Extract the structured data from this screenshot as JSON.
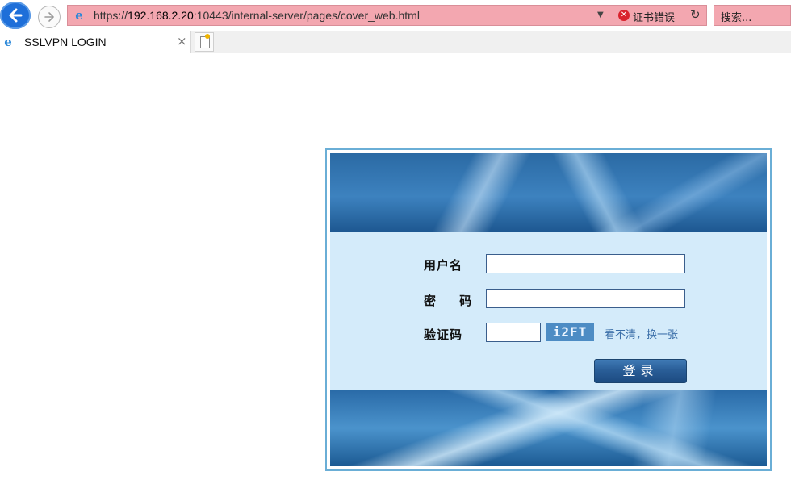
{
  "browser": {
    "url_scheme": "https://",
    "url_host": "192.168.2.20",
    "url_rest": ":10443/internal-server/pages/cover_web.html",
    "cert_error": "证书错误",
    "search_placeholder": "搜索...",
    "tab_title": "SSLVPN LOGIN",
    "tab_close": "×",
    "address_bar_color": "#f3a7b0"
  },
  "login": {
    "username_label": "用户名",
    "password_label": "密 码",
    "captcha_label": "验证码",
    "captcha_text": "i2FT",
    "captcha_refresh": "看不清，换一张",
    "submit_label": "登录"
  }
}
